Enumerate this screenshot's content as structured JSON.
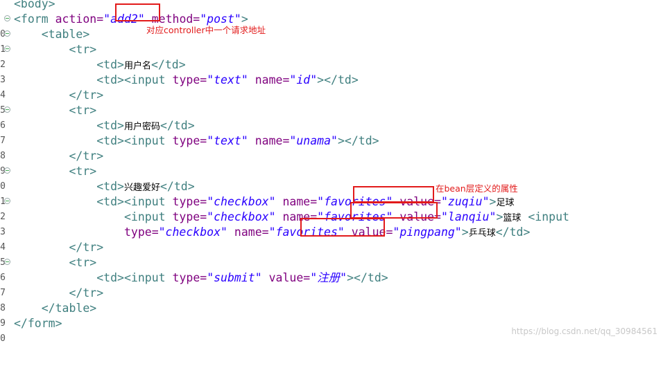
{
  "editor": {
    "lines": [
      {
        "ln": "",
        "fold": false,
        "html": ""
      },
      {
        "ln": "0",
        "fold": true
      },
      {
        "ln": "1",
        "fold": true
      },
      {
        "ln": "2",
        "fold": true
      },
      {
        "ln": "3",
        "fold": false
      },
      {
        "ln": "4",
        "fold": false
      },
      {
        "ln": "5",
        "fold": false
      },
      {
        "ln": "6",
        "fold": true
      },
      {
        "ln": "7",
        "fold": false
      },
      {
        "ln": "8",
        "fold": false
      },
      {
        "ln": "9",
        "fold": false
      },
      {
        "ln": "0",
        "fold": true
      },
      {
        "ln": "1",
        "fold": false
      },
      {
        "ln": "2",
        "fold": true
      },
      {
        "ln": "3",
        "fold": false
      },
      {
        "ln": "4",
        "fold": false
      },
      {
        "ln": "5",
        "fold": false
      },
      {
        "ln": "6",
        "fold": true
      },
      {
        "ln": "7",
        "fold": false
      },
      {
        "ln": "8",
        "fold": false
      },
      {
        "ln": "9",
        "fold": false
      },
      {
        "ln": "0",
        "fold": false
      }
    ],
    "code": {
      "l0": "<body>",
      "form_open": "<form",
      "action_attr": "action=",
      "action_val": "\"add2\"",
      "method_attr": "method=",
      "method_val": "\"post\"",
      "gt": ">",
      "table_open": "<table>",
      "tr_open": "<tr>",
      "tr_close": "</tr>",
      "td_open": "<td>",
      "td_close": "</td>",
      "input_open": "<input",
      "type_attr": "type=",
      "name_attr": "name=",
      "value_attr": "value=",
      "text_val": "\"text\"",
      "id_val": "\"id\"",
      "unama_val": "\"unama\"",
      "checkbox_val": "\"checkbox\"",
      "favorites_val": "\"favorites\"",
      "zuqiu_val": "\"zuqiu\"",
      "lanqiu_val": "\"lanqiu\"",
      "pingpang_val": "\"pingpang\"",
      "submit_val": "\"submit\"",
      "zhuce_val": "\"注册\"",
      "label_username": "用户名",
      "label_password": "用户密码",
      "label_hobby": "兴趣爱好",
      "zuqiu_text": "足球",
      "lanqiu_text": "篮球",
      "pingpang_text": "乒乓球",
      "table_close": "</table>",
      "form_close": "</form>",
      "td_input_close": "></td>"
    },
    "annotations": {
      "controller_note": "对应controller中一个请求地址",
      "bean_note": "在bean层定义的属性"
    },
    "watermark": "https://blog.csdn.net/qq_30984561",
    "colors": {
      "tag": "#3f7f7f",
      "attr": "#7f007f",
      "value": "#2a00ff",
      "annotation": "#e21a1a"
    }
  }
}
